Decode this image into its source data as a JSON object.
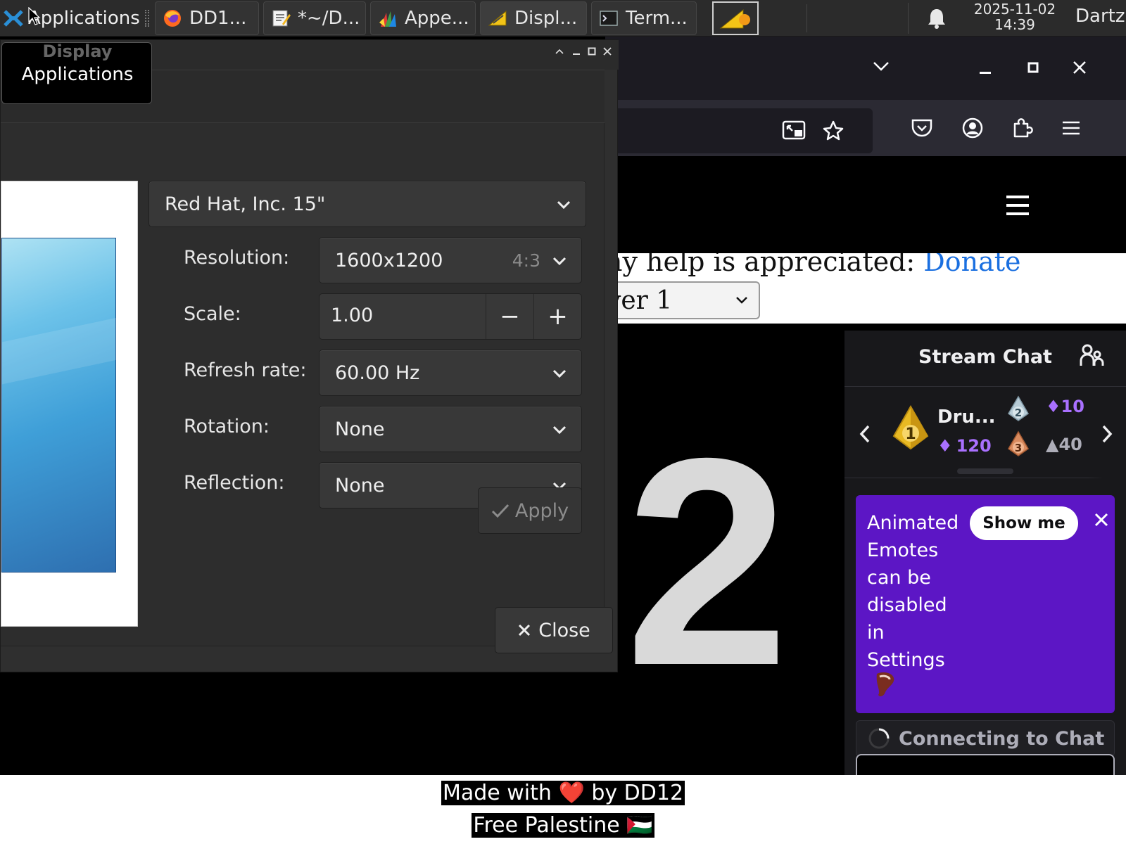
{
  "taskbar": {
    "apps_label": "Applications",
    "tasks": [
      {
        "label": "DD1...",
        "icon": "firefox-icon"
      },
      {
        "label": "*~/D...",
        "icon": "text-editor-icon"
      },
      {
        "label": "Appe...",
        "icon": "appearance-icon"
      },
      {
        "label": "Displ...",
        "icon": "display-settings-icon"
      },
      {
        "label": "Term...",
        "icon": "terminal-icon"
      }
    ],
    "clock_date": "2025-11-02",
    "clock_time": "14:39",
    "user": "Dartz"
  },
  "tooltip": {
    "title": "Display",
    "body": "Applications"
  },
  "display_dialog": {
    "monitor_selector": "Red Hat, Inc. 15\"",
    "resolution_label": "Resolution:",
    "resolution_value": "1600x1200",
    "aspect_ratio": "4:3",
    "scale_label": "Scale:",
    "scale_value": "1.00",
    "scale_minus": "−",
    "scale_plus": "+",
    "refresh_label": "Refresh rate:",
    "refresh_value": "60.00 Hz",
    "rotation_label": "Rotation:",
    "rotation_value": "None",
    "reflection_label": "Reflection:",
    "reflection_value": "None",
    "apply_label": "Apply",
    "close_label": "Close"
  },
  "webpage": {
    "help_text": "ny help is appreciated: ",
    "donate_link": "Donate",
    "server_select": "ver 1",
    "countdown_digit": "2"
  },
  "chat": {
    "title": "Stream Chat",
    "leader_name": "Dru...",
    "leader_points": "120",
    "second_points": "10",
    "third_points": "40",
    "notice_text": "Animated Emotes can be disabled in Settings",
    "show_me": "Show me",
    "connecting": "Connecting to Chat"
  },
  "footer": {
    "line1": "Made with ❤️ by DD12",
    "line2": "Free Palestine 🇵🇸"
  },
  "colors": {
    "chat_notice": "#5c16c5",
    "link": "#1a6fe0",
    "points_purple": "#a970ff"
  }
}
